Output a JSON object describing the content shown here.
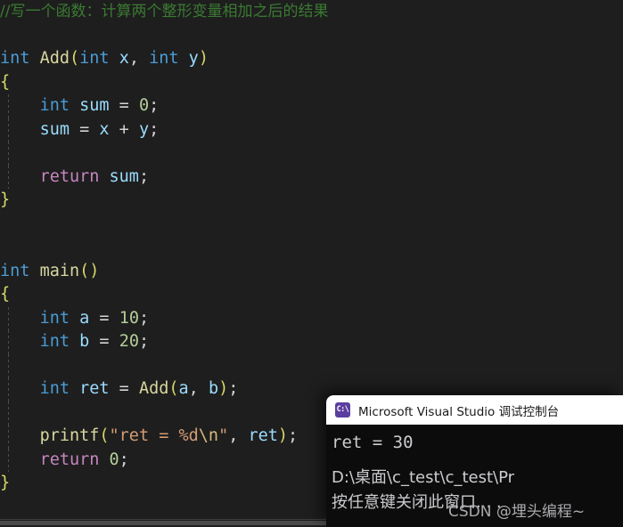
{
  "editor": {
    "background_color": "#1e1e1e",
    "lines": [
      {
        "indent": 0,
        "guide": false,
        "tokens": [
          {
            "t": "//写一个函数：计算两个整形变量相加之后的结果",
            "c": "cmt cn-comment"
          }
        ]
      },
      {
        "indent": 0,
        "guide": false,
        "tokens": []
      },
      {
        "indent": 0,
        "guide": false,
        "tokens": [
          {
            "t": "int",
            "c": "kw"
          },
          {
            "t": " ",
            "c": "pn"
          },
          {
            "t": "Add",
            "c": "fn"
          },
          {
            "t": "(",
            "c": "br"
          },
          {
            "t": "int",
            "c": "kw"
          },
          {
            "t": " ",
            "c": "pn"
          },
          {
            "t": "x",
            "c": "var"
          },
          {
            "t": ", ",
            "c": "pn"
          },
          {
            "t": "int",
            "c": "kw"
          },
          {
            "t": " ",
            "c": "pn"
          },
          {
            "t": "y",
            "c": "var"
          },
          {
            "t": ")",
            "c": "br"
          }
        ]
      },
      {
        "indent": 0,
        "guide": false,
        "tokens": [
          {
            "t": "{",
            "c": "br"
          }
        ]
      },
      {
        "indent": 1,
        "guide": true,
        "tokens": [
          {
            "t": "int",
            "c": "kw"
          },
          {
            "t": " ",
            "c": "pn"
          },
          {
            "t": "sum",
            "c": "var"
          },
          {
            "t": " = ",
            "c": "op"
          },
          {
            "t": "0",
            "c": "num"
          },
          {
            "t": ";",
            "c": "pn"
          }
        ]
      },
      {
        "indent": 1,
        "guide": true,
        "tokens": [
          {
            "t": "sum",
            "c": "var"
          },
          {
            "t": " = ",
            "c": "op"
          },
          {
            "t": "x",
            "c": "var"
          },
          {
            "t": " + ",
            "c": "op"
          },
          {
            "t": "y",
            "c": "var"
          },
          {
            "t": ";",
            "c": "pn"
          }
        ]
      },
      {
        "indent": 1,
        "guide": true,
        "tokens": []
      },
      {
        "indent": 1,
        "guide": true,
        "tokens": [
          {
            "t": "return",
            "c": "ret"
          },
          {
            "t": " ",
            "c": "pn"
          },
          {
            "t": "sum",
            "c": "var"
          },
          {
            "t": ";",
            "c": "pn"
          }
        ]
      },
      {
        "indent": 0,
        "guide": false,
        "tokens": [
          {
            "t": "}",
            "c": "br"
          }
        ]
      },
      {
        "indent": 0,
        "guide": false,
        "tokens": []
      },
      {
        "indent": 0,
        "guide": false,
        "tokens": []
      },
      {
        "indent": 0,
        "guide": false,
        "tokens": [
          {
            "t": "int",
            "c": "kw"
          },
          {
            "t": " ",
            "c": "pn"
          },
          {
            "t": "main",
            "c": "fn"
          },
          {
            "t": "()",
            "c": "br"
          }
        ]
      },
      {
        "indent": 0,
        "guide": false,
        "tokens": [
          {
            "t": "{",
            "c": "br"
          }
        ]
      },
      {
        "indent": 1,
        "guide": true,
        "tokens": [
          {
            "t": "int",
            "c": "kw"
          },
          {
            "t": " ",
            "c": "pn"
          },
          {
            "t": "a",
            "c": "var"
          },
          {
            "t": " = ",
            "c": "op"
          },
          {
            "t": "10",
            "c": "num"
          },
          {
            "t": ";",
            "c": "pn"
          }
        ]
      },
      {
        "indent": 1,
        "guide": true,
        "tokens": [
          {
            "t": "int",
            "c": "kw"
          },
          {
            "t": " ",
            "c": "pn"
          },
          {
            "t": "b",
            "c": "var"
          },
          {
            "t": " = ",
            "c": "op"
          },
          {
            "t": "20",
            "c": "num"
          },
          {
            "t": ";",
            "c": "pn"
          }
        ]
      },
      {
        "indent": 1,
        "guide": true,
        "tokens": []
      },
      {
        "indent": 1,
        "guide": true,
        "tokens": [
          {
            "t": "int",
            "c": "kw"
          },
          {
            "t": " ",
            "c": "pn"
          },
          {
            "t": "ret",
            "c": "var"
          },
          {
            "t": " = ",
            "c": "op"
          },
          {
            "t": "Add",
            "c": "fn"
          },
          {
            "t": "(",
            "c": "br"
          },
          {
            "t": "a",
            "c": "var"
          },
          {
            "t": ", ",
            "c": "pn"
          },
          {
            "t": "b",
            "c": "var"
          },
          {
            "t": ")",
            "c": "br"
          },
          {
            "t": ";",
            "c": "pn"
          }
        ]
      },
      {
        "indent": 1,
        "guide": true,
        "tokens": []
      },
      {
        "indent": 1,
        "guide": true,
        "tokens": [
          {
            "t": "printf",
            "c": "fn"
          },
          {
            "t": "(",
            "c": "br"
          },
          {
            "t": "\"ret = %d",
            "c": "str"
          },
          {
            "t": "\\n",
            "c": "esc"
          },
          {
            "t": "\"",
            "c": "str"
          },
          {
            "t": ", ",
            "c": "pn"
          },
          {
            "t": "ret",
            "c": "var"
          },
          {
            "t": ")",
            "c": "br"
          },
          {
            "t": ";",
            "c": "pn"
          }
        ]
      },
      {
        "indent": 1,
        "guide": true,
        "tokens": [
          {
            "t": "return",
            "c": "ret"
          },
          {
            "t": " ",
            "c": "pn"
          },
          {
            "t": "0",
            "c": "num"
          },
          {
            "t": ";",
            "c": "pn"
          }
        ]
      },
      {
        "indent": 0,
        "guide": false,
        "tokens": [
          {
            "t": "}",
            "c": "br"
          }
        ]
      }
    ]
  },
  "console": {
    "title": "Microsoft Visual Studio 调试控制台",
    "icon": "console-cmd-icon",
    "icon_label": "C:\\",
    "output": [
      {
        "text": "ret = 30",
        "cn": false
      },
      {
        "text": "",
        "cn": false
      },
      {
        "text": "D:\\桌面\\c_test\\c_test\\Pr",
        "cn": true
      },
      {
        "text": "按任意键关闭此窗口. . .",
        "cn": true
      }
    ]
  },
  "watermark": {
    "text": "CSDN @埋头编程~"
  },
  "scrollbar": {
    "horizontal_visible": true
  }
}
